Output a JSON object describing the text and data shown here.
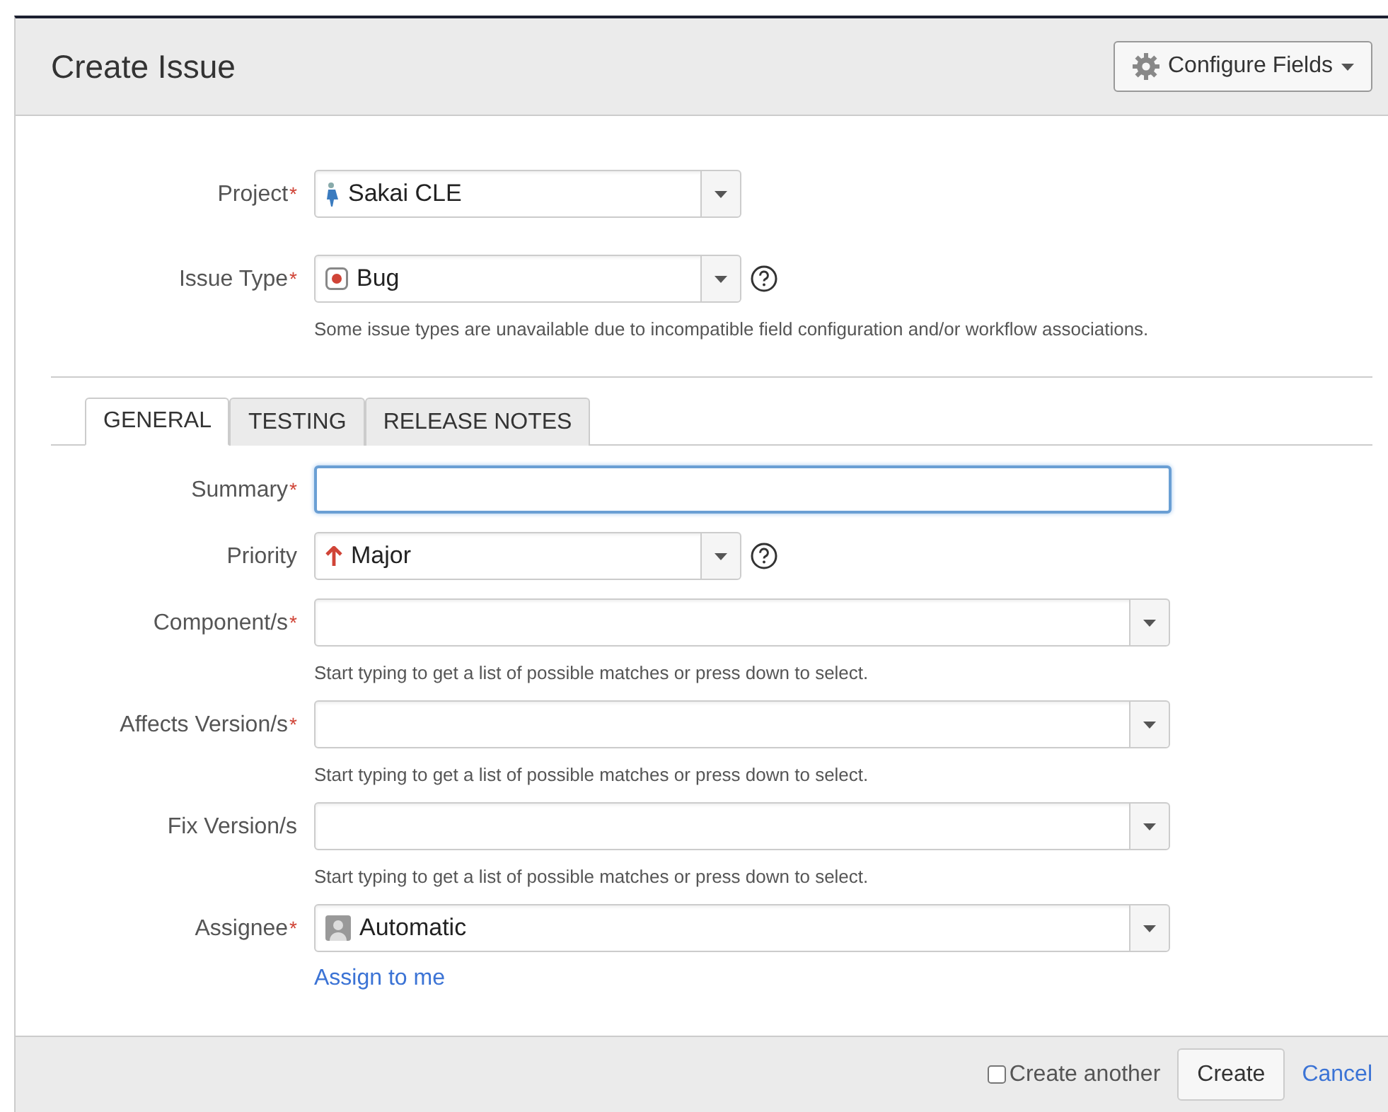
{
  "dialog": {
    "title": "Create Issue",
    "configure_button": "Configure Fields"
  },
  "top_fields": [
    {
      "kind": "select",
      "label": "Project",
      "required_mark": "*",
      "value": "Sakai CLE",
      "help": false
    },
    {
      "kind": "select",
      "label": "Issue Type",
      "required_mark": "*",
      "value": "Bug",
      "help": true,
      "hint": "Some issue types are unavailable due to incompatible field configuration and/or workflow associations."
    }
  ],
  "tabs": [
    {
      "label": "GENERAL",
      "selected": true
    },
    {
      "label": "TESTING",
      "selected": false
    },
    {
      "label": "RELEASE NOTES",
      "selected": false
    }
  ],
  "fields": [
    {
      "kind": "text",
      "label": "Summary",
      "required_mark": "*",
      "focused": true
    },
    {
      "kind": "select",
      "label": "Priority",
      "value": "Major",
      "help": true
    },
    {
      "kind": "combobox",
      "label": "Component/s",
      "required_mark": "*",
      "help": false,
      "hint": "Start typing to get a list of possible matches or press down to select."
    },
    {
      "kind": "combobox",
      "label": "Affects Version/s",
      "required_mark": "*",
      "help": false,
      "hint": "Start typing to get a list of possible matches or press down to select."
    },
    {
      "kind": "combobox",
      "label": "Fix Version/s",
      "help": false,
      "hint": "Start typing to get a list of possible matches or press down to select."
    },
    {
      "kind": "combobox",
      "label": "Assignee",
      "required_mark": "*",
      "value": "Automatic",
      "help": false,
      "link": "Assign to me"
    }
  ],
  "footer": {
    "create_another": {
      "label": "Create another",
      "checked": false
    },
    "create_button": "Create",
    "cancel_link": "Cancel"
  }
}
